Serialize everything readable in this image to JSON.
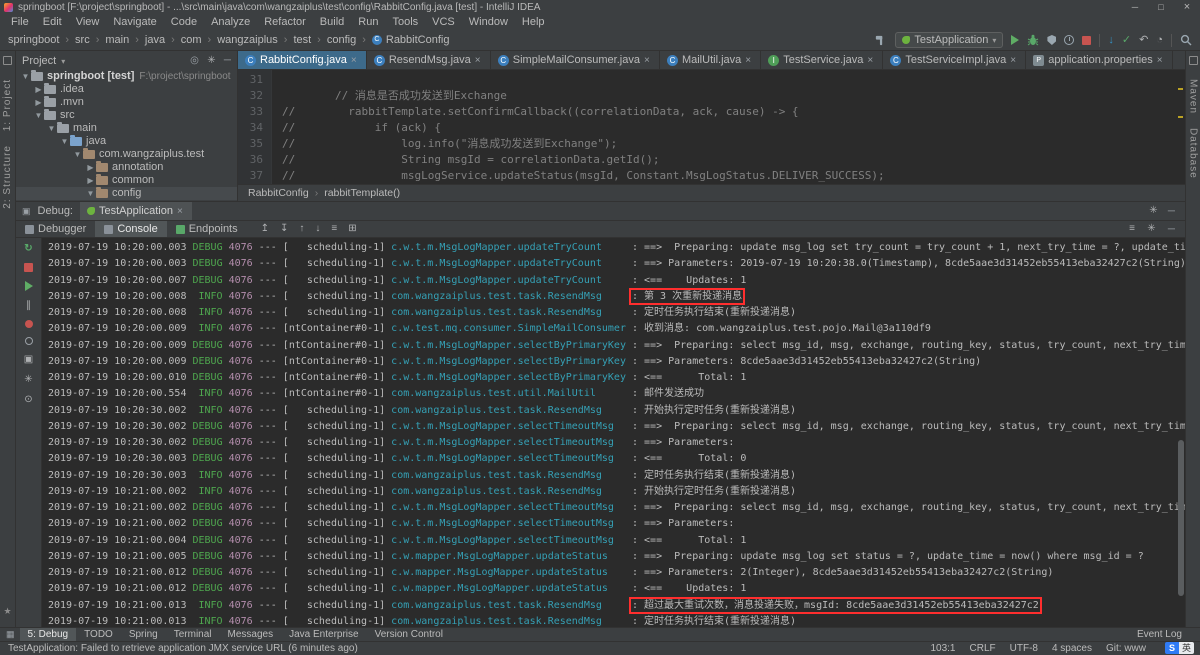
{
  "titlebar": {
    "title": "springboot [F:\\project\\springboot] - ...\\src\\main\\java\\com\\wangzaiplus\\test\\config\\RabbitConfig.java [test] - IntelliJ IDEA"
  },
  "menu": {
    "items": [
      {
        "label": "File"
      },
      {
        "label": "Edit"
      },
      {
        "label": "View"
      },
      {
        "label": "Navigate"
      },
      {
        "label": "Code"
      },
      {
        "label": "Analyze"
      },
      {
        "label": "Refactor"
      },
      {
        "label": "Build"
      },
      {
        "label": "Run"
      },
      {
        "label": "Tools"
      },
      {
        "label": "VCS"
      },
      {
        "label": "Window"
      },
      {
        "label": "Help"
      }
    ]
  },
  "navbar": {
    "crumbs": [
      {
        "label": "springboot"
      },
      {
        "label": "src"
      },
      {
        "label": "main"
      },
      {
        "label": "java"
      },
      {
        "label": "com"
      },
      {
        "label": "wangzaiplus"
      },
      {
        "label": "test"
      },
      {
        "label": "config"
      },
      {
        "label": "RabbitConfig",
        "icon": true
      }
    ],
    "run_config": "TestApplication"
  },
  "project": {
    "header": "Project",
    "tree": [
      {
        "arrow": "▼",
        "icon": "project",
        "label": "springboot [test]",
        "deco": "F:\\project\\springboot",
        "depth": 0,
        "bold": true
      },
      {
        "arrow": "▶",
        "icon": "folder",
        "label": ".idea",
        "depth": 1
      },
      {
        "arrow": "▶",
        "icon": "folder",
        "label": ".mvn",
        "depth": 1
      },
      {
        "arrow": "▼",
        "icon": "folder",
        "label": "src",
        "depth": 1
      },
      {
        "arrow": "▼",
        "icon": "folder",
        "label": "main",
        "depth": 2
      },
      {
        "arrow": "▼",
        "icon": "folder-src",
        "label": "java",
        "depth": 3
      },
      {
        "arrow": "▼",
        "icon": "package",
        "label": "com.wangzaiplus.test",
        "depth": 4
      },
      {
        "arrow": "▶",
        "icon": "package",
        "label": "annotation",
        "depth": 5
      },
      {
        "arrow": "▶",
        "icon": "package",
        "label": "common",
        "depth": 5
      },
      {
        "arrow": "▼",
        "icon": "package",
        "label": "config",
        "depth": 5,
        "selected": true
      }
    ]
  },
  "tabs": [
    {
      "label": "RabbitConfig.java",
      "icon": "C",
      "active": true
    },
    {
      "label": "ResendMsg.java",
      "icon": "C"
    },
    {
      "label": "SimpleMailConsumer.java",
      "icon": "C"
    },
    {
      "label": "MailUtil.java",
      "icon": "C"
    },
    {
      "label": "TestService.java",
      "icon": "I"
    },
    {
      "label": "TestServiceImpl.java",
      "icon": "C"
    },
    {
      "label": "application.properties",
      "icon": "P"
    }
  ],
  "editor": {
    "lines": [
      {
        "n": "31",
        "t": ""
      },
      {
        "n": "32",
        "t": "        // 消息是否成功发送到Exchange"
      },
      {
        "n": "33",
        "t": "//        rabbitTemplate.setConfirmCallback((correlationData, ack, cause) -> {"
      },
      {
        "n": "34",
        "t": "//            if (ack) {"
      },
      {
        "n": "35",
        "t": "//                log.info(\"消息成功发送到Exchange\");"
      },
      {
        "n": "36",
        "t": "//                String msgId = correlationData.getId();"
      },
      {
        "n": "37",
        "t": "//                msgLogService.updateStatus(msgId, Constant.MsgLogStatus.DELIVER_SUCCESS);"
      }
    ],
    "breadcrumbs": [
      {
        "label": "RabbitConfig"
      },
      {
        "label": "rabbitTemplate()"
      }
    ]
  },
  "debug": {
    "label": "Debug:",
    "session": "TestApplication",
    "sep": "---",
    "views": [
      {
        "label": "Debugger"
      },
      {
        "label": "Console",
        "active": true
      }
    ],
    "endpoints": "Endpoints",
    "console": [
      {
        "ts": "2019-07-19 10:20:00.003",
        "lvl": "DEBUG",
        "pid": "4076",
        "thr": "scheduling-1",
        "log": "c.w.t.m.MsgLogMapper.updateTryCount",
        "msg": ": ==>  Preparing: update msg_log set try_count = try_count + 1, next_try_time = ?, update_time = now()"
      },
      {
        "ts": "2019-07-19 10:20:00.003",
        "lvl": "DEBUG",
        "pid": "4076",
        "thr": "scheduling-1",
        "log": "c.w.t.m.MsgLogMapper.updateTryCount",
        "msg": ": ==> Parameters: 2019-07-19 10:20:38.0(Timestamp), 8cde5aae3d31452eb55413eba32427c2(String)"
      },
      {
        "ts": "2019-07-19 10:20:00.007",
        "lvl": "DEBUG",
        "pid": "4076",
        "thr": "scheduling-1",
        "log": "c.w.t.m.MsgLogMapper.updateTryCount",
        "msg": ": <==    Updates: 1"
      },
      {
        "ts": "2019-07-19 10:20:00.008",
        "lvl": "INFO",
        "pid": "4076",
        "thr": "scheduling-1",
        "log": "com.wangzaiplus.test.task.ResendMsg",
        "msg": ": 第 3 次重新投递消息",
        "boxed": true
      },
      {
        "ts": "2019-07-19 10:20:00.008",
        "lvl": "INFO",
        "pid": "4076",
        "thr": "scheduling-1",
        "log": "com.wangzaiplus.test.task.ResendMsg",
        "msg": ": 定时任务执行结束(重新投递消息)"
      },
      {
        "ts": "2019-07-19 10:20:00.009",
        "lvl": "INFO",
        "pid": "4076",
        "thr": "ntContainer#0-1",
        "log": "c.w.test.mq.consumer.SimpleMailConsumer",
        "msg": ": 收到消息: com.wangzaiplus.test.pojo.Mail@3a110df9"
      },
      {
        "ts": "2019-07-19 10:20:00.009",
        "lvl": "DEBUG",
        "pid": "4076",
        "thr": "ntContainer#0-1",
        "log": "c.w.t.m.MsgLogMapper.selectByPrimaryKey",
        "msg": ": ==>  Preparing: select msg_id, msg, exchange, routing_key, status, try_count, next_try_time, create_t"
      },
      {
        "ts": "2019-07-19 10:20:00.009",
        "lvl": "DEBUG",
        "pid": "4076",
        "thr": "ntContainer#0-1",
        "log": "c.w.t.m.MsgLogMapper.selectByPrimaryKey",
        "msg": ": ==> Parameters: 8cde5aae3d31452eb55413eba32427c2(String)"
      },
      {
        "ts": "2019-07-19 10:20:00.010",
        "lvl": "DEBUG",
        "pid": "4076",
        "thr": "ntContainer#0-1",
        "log": "c.w.t.m.MsgLogMapper.selectByPrimaryKey",
        "msg": ": <==      Total: 1"
      },
      {
        "ts": "2019-07-19 10:20:00.554",
        "lvl": "INFO",
        "pid": "4076",
        "thr": "ntContainer#0-1",
        "log": "com.wangzaiplus.test.util.MailUtil",
        "msg": ": 邮件发送成功"
      },
      {
        "ts": "2019-07-19 10:20:30.002",
        "lvl": "INFO",
        "pid": "4076",
        "thr": "scheduling-1",
        "log": "com.wangzaiplus.test.task.ResendMsg",
        "msg": ": 开始执行定时任务(重新投递消息)"
      },
      {
        "ts": "2019-07-19 10:20:30.002",
        "lvl": "DEBUG",
        "pid": "4076",
        "thr": "scheduling-1",
        "log": "c.w.t.m.MsgLogMapper.selectTimeoutMsg",
        "msg": ": ==>  Preparing: select msg_id, msg, exchange, routing_key, status, try_count, next_try_time, create_t"
      },
      {
        "ts": "2019-07-19 10:20:30.002",
        "lvl": "DEBUG",
        "pid": "4076",
        "thr": "scheduling-1",
        "log": "c.w.t.m.MsgLogMapper.selectTimeoutMsg",
        "msg": ": ==> Parameters: "
      },
      {
        "ts": "2019-07-19 10:20:30.003",
        "lvl": "DEBUG",
        "pid": "4076",
        "thr": "scheduling-1",
        "log": "c.w.t.m.MsgLogMapper.selectTimeoutMsg",
        "msg": ": <==      Total: 0"
      },
      {
        "ts": "2019-07-19 10:20:30.003",
        "lvl": "INFO",
        "pid": "4076",
        "thr": "scheduling-1",
        "log": "com.wangzaiplus.test.task.ResendMsg",
        "msg": ": 定时任务执行结束(重新投递消息)"
      },
      {
        "ts": "2019-07-19 10:21:00.002",
        "lvl": "INFO",
        "pid": "4076",
        "thr": "scheduling-1",
        "log": "com.wangzaiplus.test.task.ResendMsg",
        "msg": ": 开始执行定时任务(重新投递消息)"
      },
      {
        "ts": "2019-07-19 10:21:00.002",
        "lvl": "DEBUG",
        "pid": "4076",
        "thr": "scheduling-1",
        "log": "c.w.t.m.MsgLogMapper.selectTimeoutMsg",
        "msg": ": ==>  Preparing: select msg_id, msg, exchange, routing_key, status, try_count, next_try_time, create_"
      },
      {
        "ts": "2019-07-19 10:21:00.002",
        "lvl": "DEBUG",
        "pid": "4076",
        "thr": "scheduling-1",
        "log": "c.w.t.m.MsgLogMapper.selectTimeoutMsg",
        "msg": ": ==> Parameters: "
      },
      {
        "ts": "2019-07-19 10:21:00.004",
        "lvl": "DEBUG",
        "pid": "4076",
        "thr": "scheduling-1",
        "log": "c.w.t.m.MsgLogMapper.selectTimeoutMsg",
        "msg": ": <==      Total: 1"
      },
      {
        "ts": "2019-07-19 10:21:00.005",
        "lvl": "DEBUG",
        "pid": "4076",
        "thr": "scheduling-1",
        "log": "c.w.mapper.MsgLogMapper.updateStatus",
        "msg": ": ==>  Preparing: update msg_log set status = ?, update_time = now() where msg_id = ?"
      },
      {
        "ts": "2019-07-19 10:21:00.012",
        "lvl": "DEBUG",
        "pid": "4076",
        "thr": "scheduling-1",
        "log": "c.w.mapper.MsgLogMapper.updateStatus",
        "msg": ": ==> Parameters: 2(Integer), 8cde5aae3d31452eb55413eba32427c2(String)"
      },
      {
        "ts": "2019-07-19 10:21:00.012",
        "lvl": "DEBUG",
        "pid": "4076",
        "thr": "scheduling-1",
        "log": "c.w.mapper.MsgLogMapper.updateStatus",
        "msg": ": <==    Updates: 1"
      },
      {
        "ts": "2019-07-19 10:21:00.013",
        "lvl": "INFO",
        "pid": "4076",
        "thr": "scheduling-1",
        "log": "com.wangzaiplus.test.task.ResendMsg",
        "msg": ": 超过最大重试次数，消息投递失败，msgId: 8cde5aae3d31452eb55413eba32427c2",
        "boxed": true
      },
      {
        "ts": "2019-07-19 10:21:00.013",
        "lvl": "INFO",
        "pid": "4076",
        "thr": "scheduling-1",
        "log": "com.wangzaiplus.test.task.ResendMsg",
        "msg": ": 定时任务执行结束(重新投递消息)"
      }
    ]
  },
  "toolwindows": {
    "left": [
      {
        "label": "1: Project"
      },
      {
        "label": "2: Structure"
      }
    ],
    "right": [
      {
        "label": "Maven"
      },
      {
        "label": "Database"
      }
    ],
    "bottom": [
      {
        "label": "5: Debug",
        "active": true
      },
      {
        "label": "TODO"
      },
      {
        "label": "Spring"
      },
      {
        "label": "Terminal"
      },
      {
        "label": "Messages"
      },
      {
        "label": "Java Enterprise"
      },
      {
        "label": "Version Control"
      }
    ],
    "event_log": "Event Log"
  },
  "statusbar": {
    "message": "TestApplication: Failed to retrieve application JMX service URL (6 minutes ago)",
    "items": [
      {
        "label": "103:1"
      },
      {
        "label": "CRLF"
      },
      {
        "label": "UTF-8"
      },
      {
        "label": "4 spaces"
      },
      {
        "label": "Git: www"
      }
    ]
  },
  "ime": {
    "s": "S",
    "lang": "英"
  }
}
